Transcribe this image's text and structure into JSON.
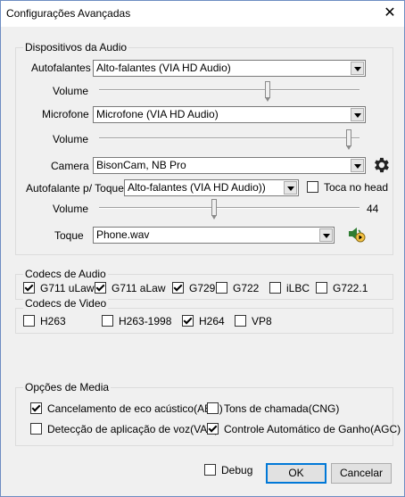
{
  "window": {
    "title": "Configurações Avançadas",
    "close_glyph": "✕"
  },
  "audio_devices": {
    "legend": "Dispositivos da Audio",
    "speakers": {
      "label": "Autofalantes",
      "value": "Alto-falantes (VIA HD Audio)"
    },
    "speakers_volume": {
      "label": "Volume",
      "level_percent": 65
    },
    "microphone": {
      "label": "Microfone",
      "value": "Microfone (VIA HD Audio)"
    },
    "microphone_volume": {
      "label": "Volume",
      "level_percent": 97
    },
    "camera": {
      "label": "Camera",
      "value": "BisonCam, NB Pro"
    },
    "ring_speaker": {
      "label": "Autofalante p/ Toque",
      "value": "Alto-falantes (VIA HD Audio))"
    },
    "headset_ring": {
      "label": "Toca no head",
      "checked": false
    },
    "ring_volume": {
      "label": "Volume",
      "value_text": "44",
      "level_percent": 44
    },
    "ringtone": {
      "label": "Toque",
      "value": "Phone.wav"
    }
  },
  "audio_codecs": {
    "legend": "Codecs de Audio",
    "items": [
      {
        "label": "G711 uLaw",
        "checked": true
      },
      {
        "label": "G711 aLaw",
        "checked": true
      },
      {
        "label": "G729",
        "checked": true
      },
      {
        "label": "G722",
        "checked": false
      },
      {
        "label": "iLBC",
        "checked": false
      },
      {
        "label": "G722.1",
        "checked": false
      }
    ]
  },
  "video_codecs": {
    "legend": "Codecs de Video",
    "items": [
      {
        "label": "H263",
        "checked": false
      },
      {
        "label": "H263-1998",
        "checked": false
      },
      {
        "label": "H264",
        "checked": true
      },
      {
        "label": "VP8",
        "checked": false
      }
    ]
  },
  "media_options": {
    "legend": "Opções de Media",
    "aec": {
      "label": "Cancelamento de eco acústico(AEC)",
      "checked": true
    },
    "cng": {
      "label": "Tons de chamada(CNG)",
      "checked": false
    },
    "vad": {
      "label": "Detecção de aplicação de voz(VAD)",
      "checked": false
    },
    "agc": {
      "label": "Controle Automático de Ganho(AGC)",
      "checked": true
    }
  },
  "footer": {
    "debug": {
      "label": "Debug",
      "checked": false
    },
    "ok_label": "OK",
    "cancel_label": "Cancelar"
  },
  "icons": {
    "settings": "gear-icon",
    "play": "speaker-play-icon"
  }
}
